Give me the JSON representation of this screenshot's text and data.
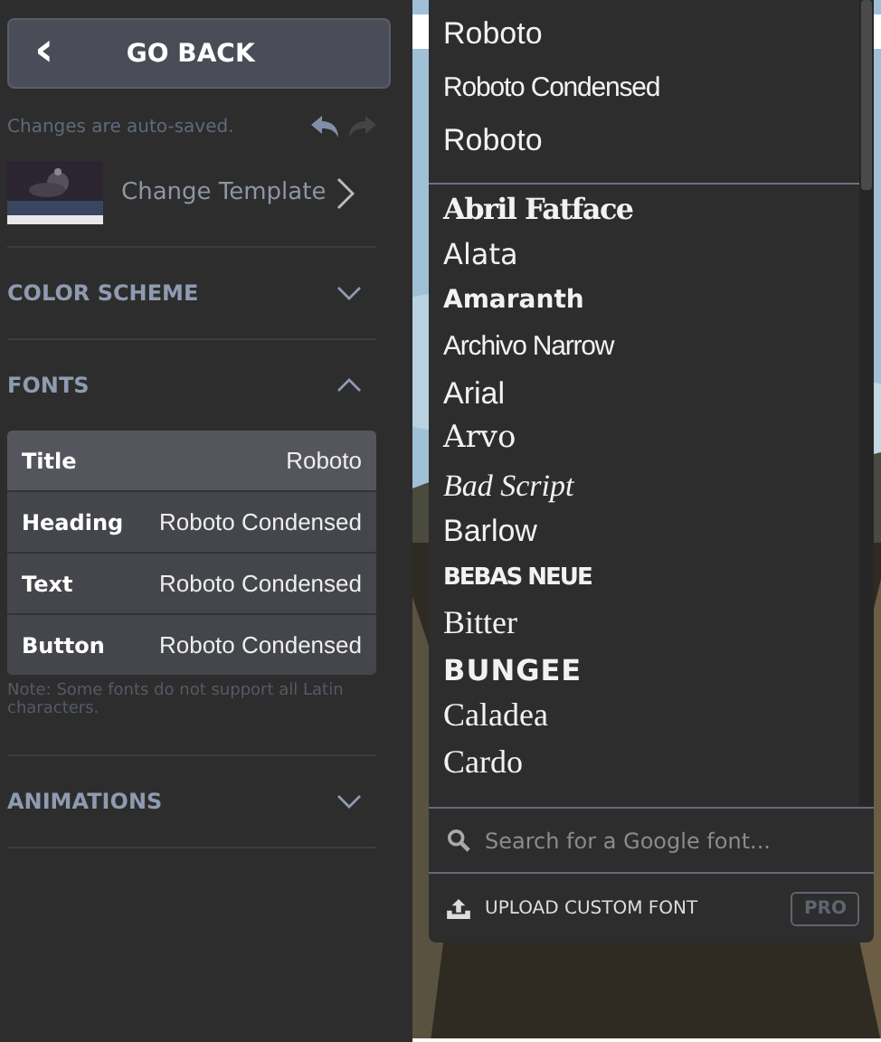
{
  "sidebar": {
    "back_button": {
      "icon": "‹",
      "label": "GO BACK"
    },
    "autosave_note": "Changes are auto-saved.",
    "undo": {
      "disabled": false
    },
    "redo": {
      "disabled": true
    },
    "template": {
      "label": "Change Template"
    },
    "sections": [
      {
        "title": "COLOR SCHEME",
        "expanded": false
      },
      {
        "title": "FONTS",
        "expanded": true,
        "font_rows": [
          {
            "role": "Title",
            "font": "Roboto",
            "selected": true
          },
          {
            "role": "Heading",
            "font": "Roboto Condensed",
            "selected": false
          },
          {
            "role": "Text",
            "font": "Roboto Condensed",
            "selected": false
          },
          {
            "role": "Button",
            "font": "Roboto Condensed",
            "selected": false
          }
        ],
        "note": "Note: Some fonts do not support all Latin characters."
      },
      {
        "title": "ANIMATIONS",
        "expanded": false
      }
    ]
  },
  "font_dropdown": {
    "in_use": [
      {
        "name": "Roboto",
        "kind": "sans"
      },
      {
        "name": "Roboto Condensed",
        "kind": "condensed"
      },
      {
        "name": "Roboto",
        "kind": "sans"
      }
    ],
    "fonts": [
      {
        "name": "Abril Fatface",
        "kind": "fatface"
      },
      {
        "name": "Alata",
        "kind": "geometric"
      },
      {
        "name": "Amaranth",
        "kind": "bold-sans"
      },
      {
        "name": "Archivo Narrow",
        "kind": "condensed"
      },
      {
        "name": "Arial",
        "kind": "sans"
      },
      {
        "name": "Arvo",
        "kind": "slab"
      },
      {
        "name": "Bad Script",
        "kind": "script"
      },
      {
        "name": "Barlow",
        "kind": "sans"
      },
      {
        "name": "BEBAS NEUE",
        "kind": "display"
      },
      {
        "name": "Bitter",
        "kind": "serif"
      },
      {
        "name": "BUNGEE",
        "kind": "block"
      },
      {
        "name": "Caladea",
        "kind": "serif"
      },
      {
        "name": "Cardo",
        "kind": "serif"
      }
    ],
    "search": {
      "placeholder": "Search for a Google font..."
    },
    "upload": {
      "label": "UPLOAD CUSTOM FONT",
      "badge": "PRO"
    }
  }
}
